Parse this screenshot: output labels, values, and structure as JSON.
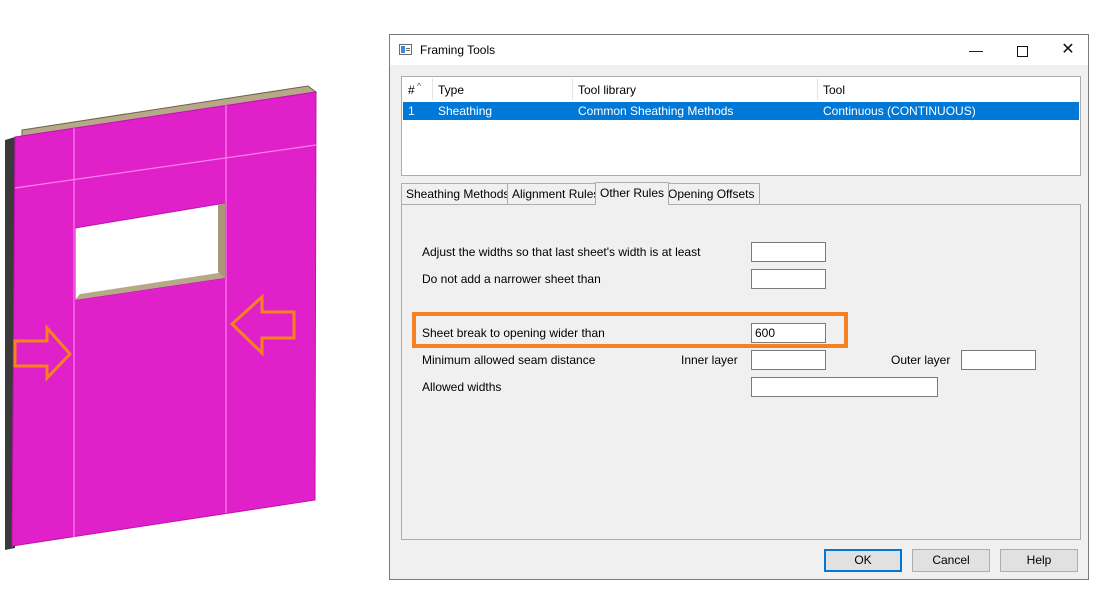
{
  "window": {
    "title": "Framing Tools",
    "minimize_glyph": "—",
    "close_glyph": "✕"
  },
  "table": {
    "columns": [
      "#",
      "Type",
      "Tool library",
      "Tool"
    ],
    "sort_indicator": "^",
    "rows": [
      {
        "num": "1",
        "type": "Sheathing",
        "library": "Common Sheathing Methods",
        "tool": "Continuous (CONTINUOUS)",
        "selected": true
      }
    ]
  },
  "tabs": [
    {
      "label": "Sheathing Methods",
      "active": false
    },
    {
      "label": "Alignment Rules",
      "active": false
    },
    {
      "label": "Other Rules",
      "active": true
    },
    {
      "label": "Opening Offsets",
      "active": false
    }
  ],
  "form": {
    "last_sheet_label": "Adjust the widths so that last sheet's width is at least",
    "last_sheet_value": "",
    "narrower_label": "Do not add a narrower sheet than",
    "narrower_value": "",
    "sheet_break_label": "Sheet break to opening wider than",
    "sheet_break_value": "600",
    "seam_label": "Minimum allowed seam distance",
    "inner_layer_label": "Inner layer",
    "inner_layer_value": "",
    "outer_layer_label": "Outer layer",
    "outer_layer_value": "",
    "allowed_widths_label": "Allowed widths",
    "allowed_widths_value": ""
  },
  "buttons": {
    "ok": "OK",
    "cancel": "Cancel",
    "help": "Help"
  },
  "colors": {
    "sheathing": "#e020c8",
    "highlight": "#f58220",
    "selection": "#0078d7"
  }
}
